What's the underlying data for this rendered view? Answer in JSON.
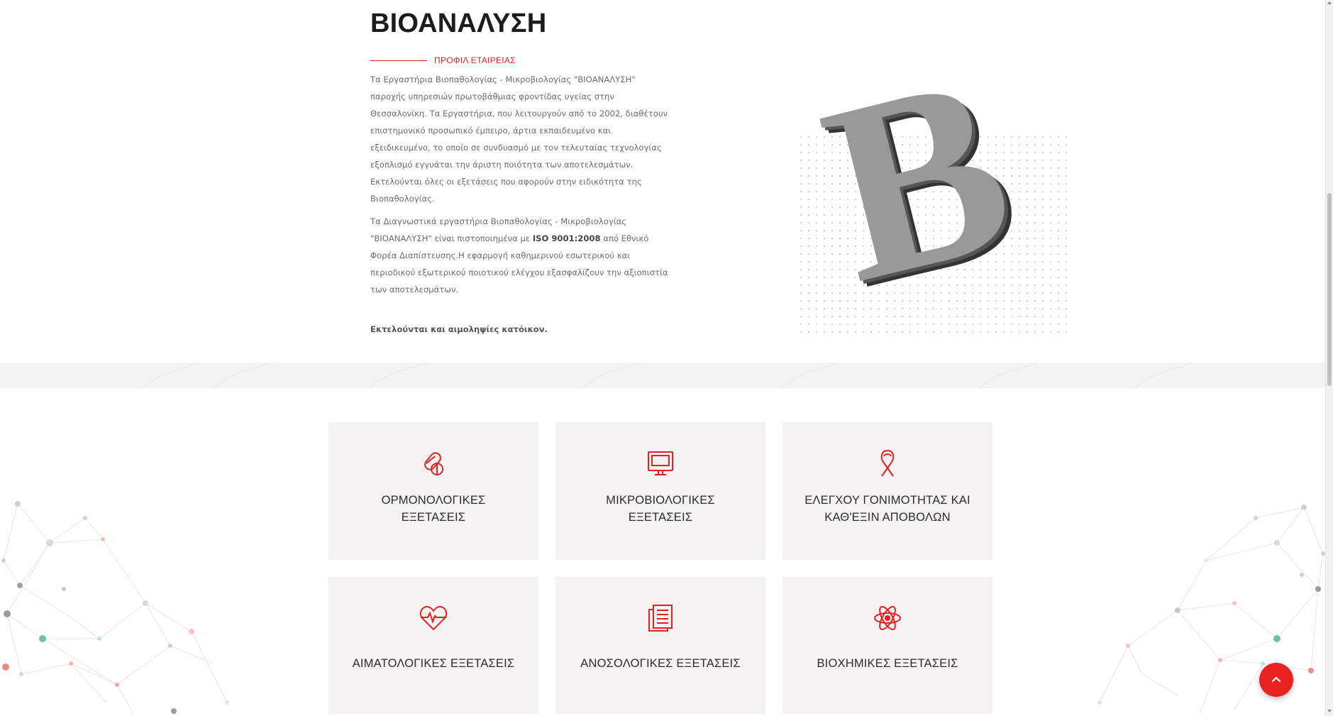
{
  "company": {
    "title": "ΒΙΟΑΝΑΛΥΣΗ",
    "subtitle": "ΠΡΟΦΙΛ ΕΤΑΙΡΕΙΑΣ"
  },
  "intro": {
    "paragraph1": "Τα Εργαστήρια Βιοπαθολογίας - Μικροβιολογίας \"ΒΙΟΑΝΑΛΥΣΗ\" παροχής υπηρεσιών πρωτοβάθμιας φροντίδας υγείας στην Θεσσαλονίκη. Τα Εργαστήρια, που λειτουργούν από το 2002, διαθέτουν επιστημονικό προσωπικό έμπειρο, άρτια εκπαιδευμένο και εξειδικευμένο, το οποίο σε συνδυασμό με τον τελευταίας τεχνολογίας εξοπλισμό εγγυάται την άριστη ποιότητα των αποτελεσμάτων. Εκτελούνται όλες οι εξετάσεις που αφορούν στην ειδικότητα της Βιοπαθολογίας.",
    "paragraph2_before": "Τα Διαγνωστικά εργαστήρια Βιοπαθολογίας - Μικροβιολογίας \"ΒΙΟΑΝΑΛΥΣΗ\" είναι πιστοποιημένα με ",
    "paragraph2_bold": "ISO 9001:2008",
    "paragraph2_after": " από Εθνικό Φορέα Διαπίστευσης.Η εφαρμογή καθημερινού εσωτερικού και περιοδικού εξωτερικού ποιοτικού ελέγχου εξασφαλίζουν την αξιοπιστία των αποτελεσμάτων.",
    "paragraph3": "Εκτελούνται και αιμοληψίες κατόικον."
  },
  "colors": {
    "accent": "#e3211f",
    "card_bg": "#f4f2f2",
    "text": "#6b6b6b"
  },
  "services": [
    {
      "label": "ΟΡΜΟΝΟΛΟΓΙΚΕΣ ΕΞΕΤΑΣΕΙΣ",
      "icon": "pills-icon"
    },
    {
      "label": "ΜΙΚΡΟΒΙΟΛΟΓΙΚΕΣ ΕΞΕΤΑΣΕΙΣ",
      "icon": "monitor-icon"
    },
    {
      "label": "ΕΛΕΓΧΟΥ ΓΟΝΙΜΟΤΗΤΑΣ ΚΑΙ ΚΑΘ'ΕΞΙΝ ΑΠΟΒΟΛΩΝ",
      "icon": "ribbon-icon"
    },
    {
      "label": "ΑΙΜΑΤΟΛΟΓΙΚΕΣ ΕΞΕΤΑΣΕΙΣ",
      "icon": "heartbeat-icon"
    },
    {
      "label": "ΑΝΟΣΟΛΟΓΙΚΕΣ ΕΞΕΤΑΣΕΙΣ",
      "icon": "document-icon"
    },
    {
      "label": "ΒΙΟΧΗΜΙΚΕΣ ΕΞΕΤΑΣΕΙΣ",
      "icon": "atom-icon"
    }
  ]
}
